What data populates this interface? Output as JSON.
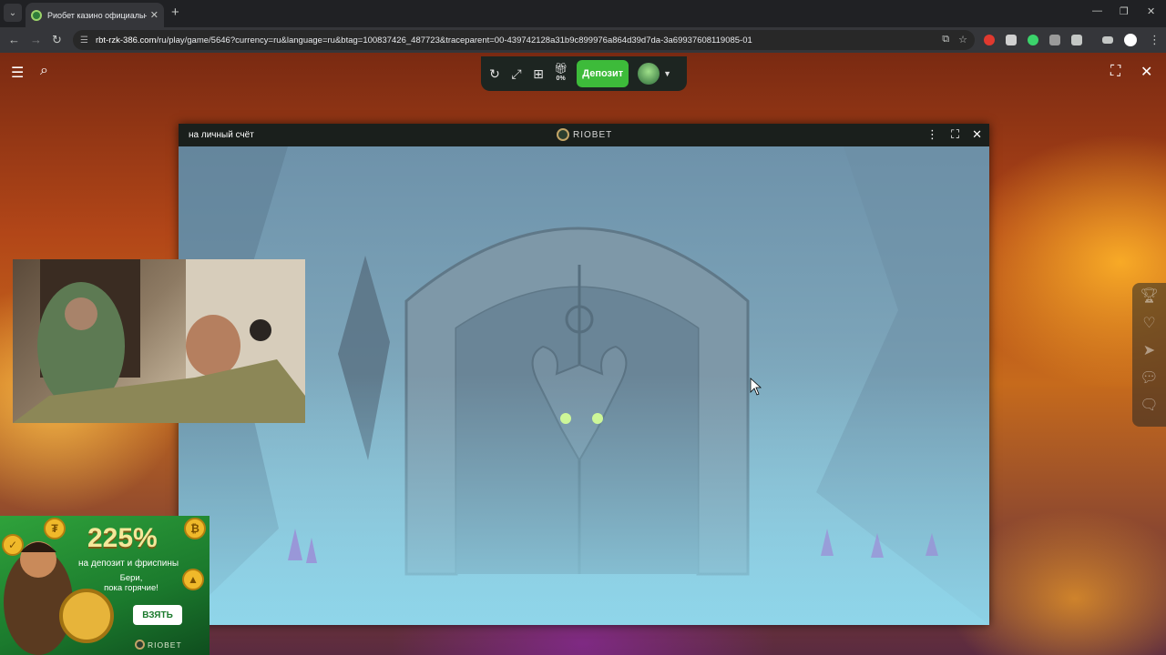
{
  "browser": {
    "tab_title": "Риобет казино официальный",
    "tab_close": "✕",
    "new_tab": "+",
    "url_host": "rbt-rzk-386.com",
    "url_path": "/ru/play/game/5646?currency=ru&language=ru&btag=100837426_487723&traceparent=00-439742128a31b9c899976a864d39d7da-3a69937608119085-01"
  },
  "game_toolbar": {
    "gift_percent": "0%",
    "deposit_label": "Депозит"
  },
  "game_window": {
    "title": "на личный счёт",
    "logo_text": "RIOBET"
  },
  "promo": {
    "percent": "225%",
    "subtitle": "на депозит и фриспины",
    "hot_line1": "Бери,",
    "hot_line2": "пока горячие!",
    "button_label": "ВЗЯТЬ",
    "logo_text": "RIOBET"
  },
  "colors": {
    "accent_green": "#3dbb3a",
    "chrome_dark": "#202124",
    "scene_blue": "#86bacd"
  }
}
